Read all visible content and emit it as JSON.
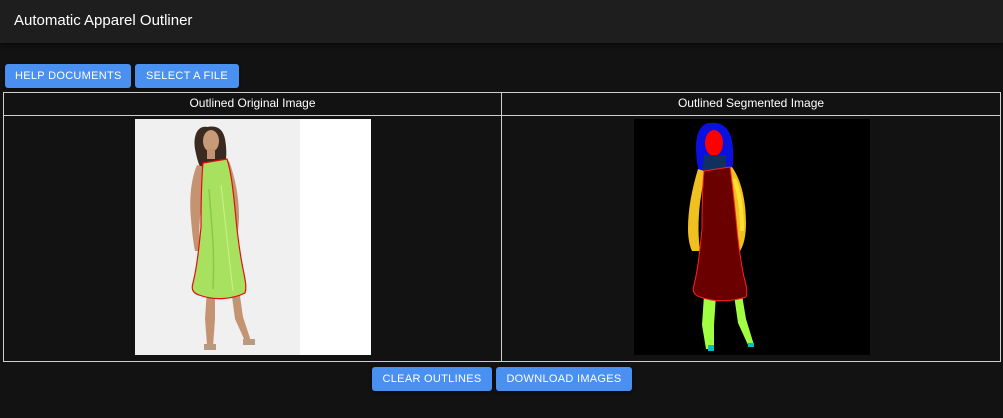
{
  "app": {
    "title": "Automatic Apparel Outliner"
  },
  "toolbar": {
    "help_label": "HELP DOCUMENTS",
    "select_label": "SELECT A FILE"
  },
  "panels": {
    "original": {
      "title": "Outlined Original Image"
    },
    "segmented": {
      "title": "Outlined Segmented Image"
    }
  },
  "actions": {
    "clear_label": "CLEAR OUTLINES",
    "download_label": "DOWNLOAD IMAGES"
  },
  "colors": {
    "accent": "#4a90f0",
    "background": "#121212",
    "appbar": "#1e1e1e",
    "outline": "#e01010",
    "dress": "#a8e060",
    "seg_hair": "#0a10e0",
    "seg_face": "#ff0000",
    "seg_dress": "#6a0000",
    "seg_arms": "#f0c020",
    "seg_legs": "#a0ff40",
    "seg_neck": "#103060"
  }
}
